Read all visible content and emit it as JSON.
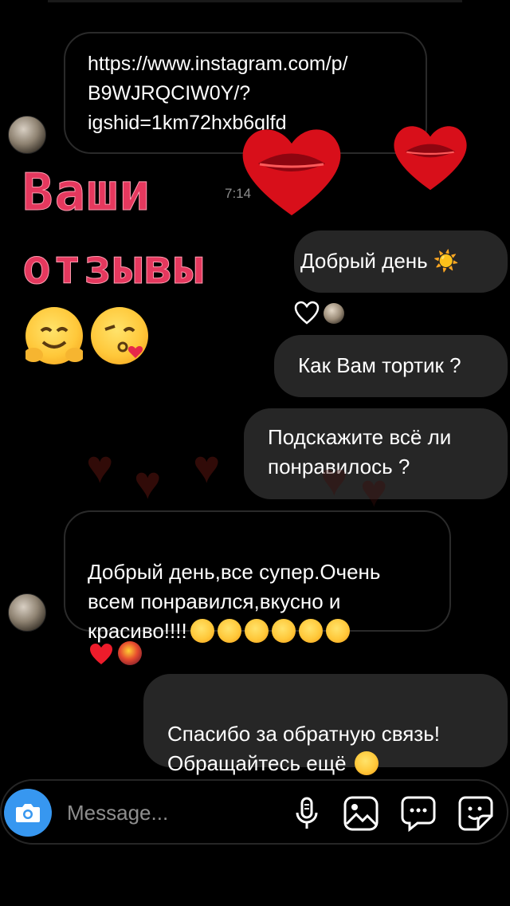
{
  "messages": {
    "link": {
      "text": "https://www.instagram.com/p/\nB9WJRQCIW0Y/?\nigshid=1km72hxb6qlfd"
    },
    "timestamp": "7:14",
    "greeting_out": {
      "text": "Добрый день ☀️"
    },
    "question1": {
      "text": "Как Вам тортик ?"
    },
    "question2": {
      "text": "Подскажите всё ли\nпонравилось ?"
    },
    "reply_in": {
      "text": "Добрый день,все супер.Очень\nвсем понравился,вкусно и\nкрасиво!!!!"
    },
    "thanks_out": {
      "text": "Спасибо за обратную связь!\nОбращайтесь ещё"
    }
  },
  "overlay": {
    "title_line1": "Ваши",
    "title_line2": "отзывы"
  },
  "composer": {
    "placeholder": "Message..."
  },
  "icons": [
    "camera-icon",
    "microphone-icon",
    "gallery-icon",
    "chat-bubble-icon",
    "sticker-icon",
    "heart-icon"
  ],
  "colors": {
    "accent_blue": "#3797f0",
    "bubble_out": "#262626",
    "overlay_pink": "#e5385e",
    "kiss_red": "#e0101a",
    "reaction_heart": "#ed1c2b"
  }
}
